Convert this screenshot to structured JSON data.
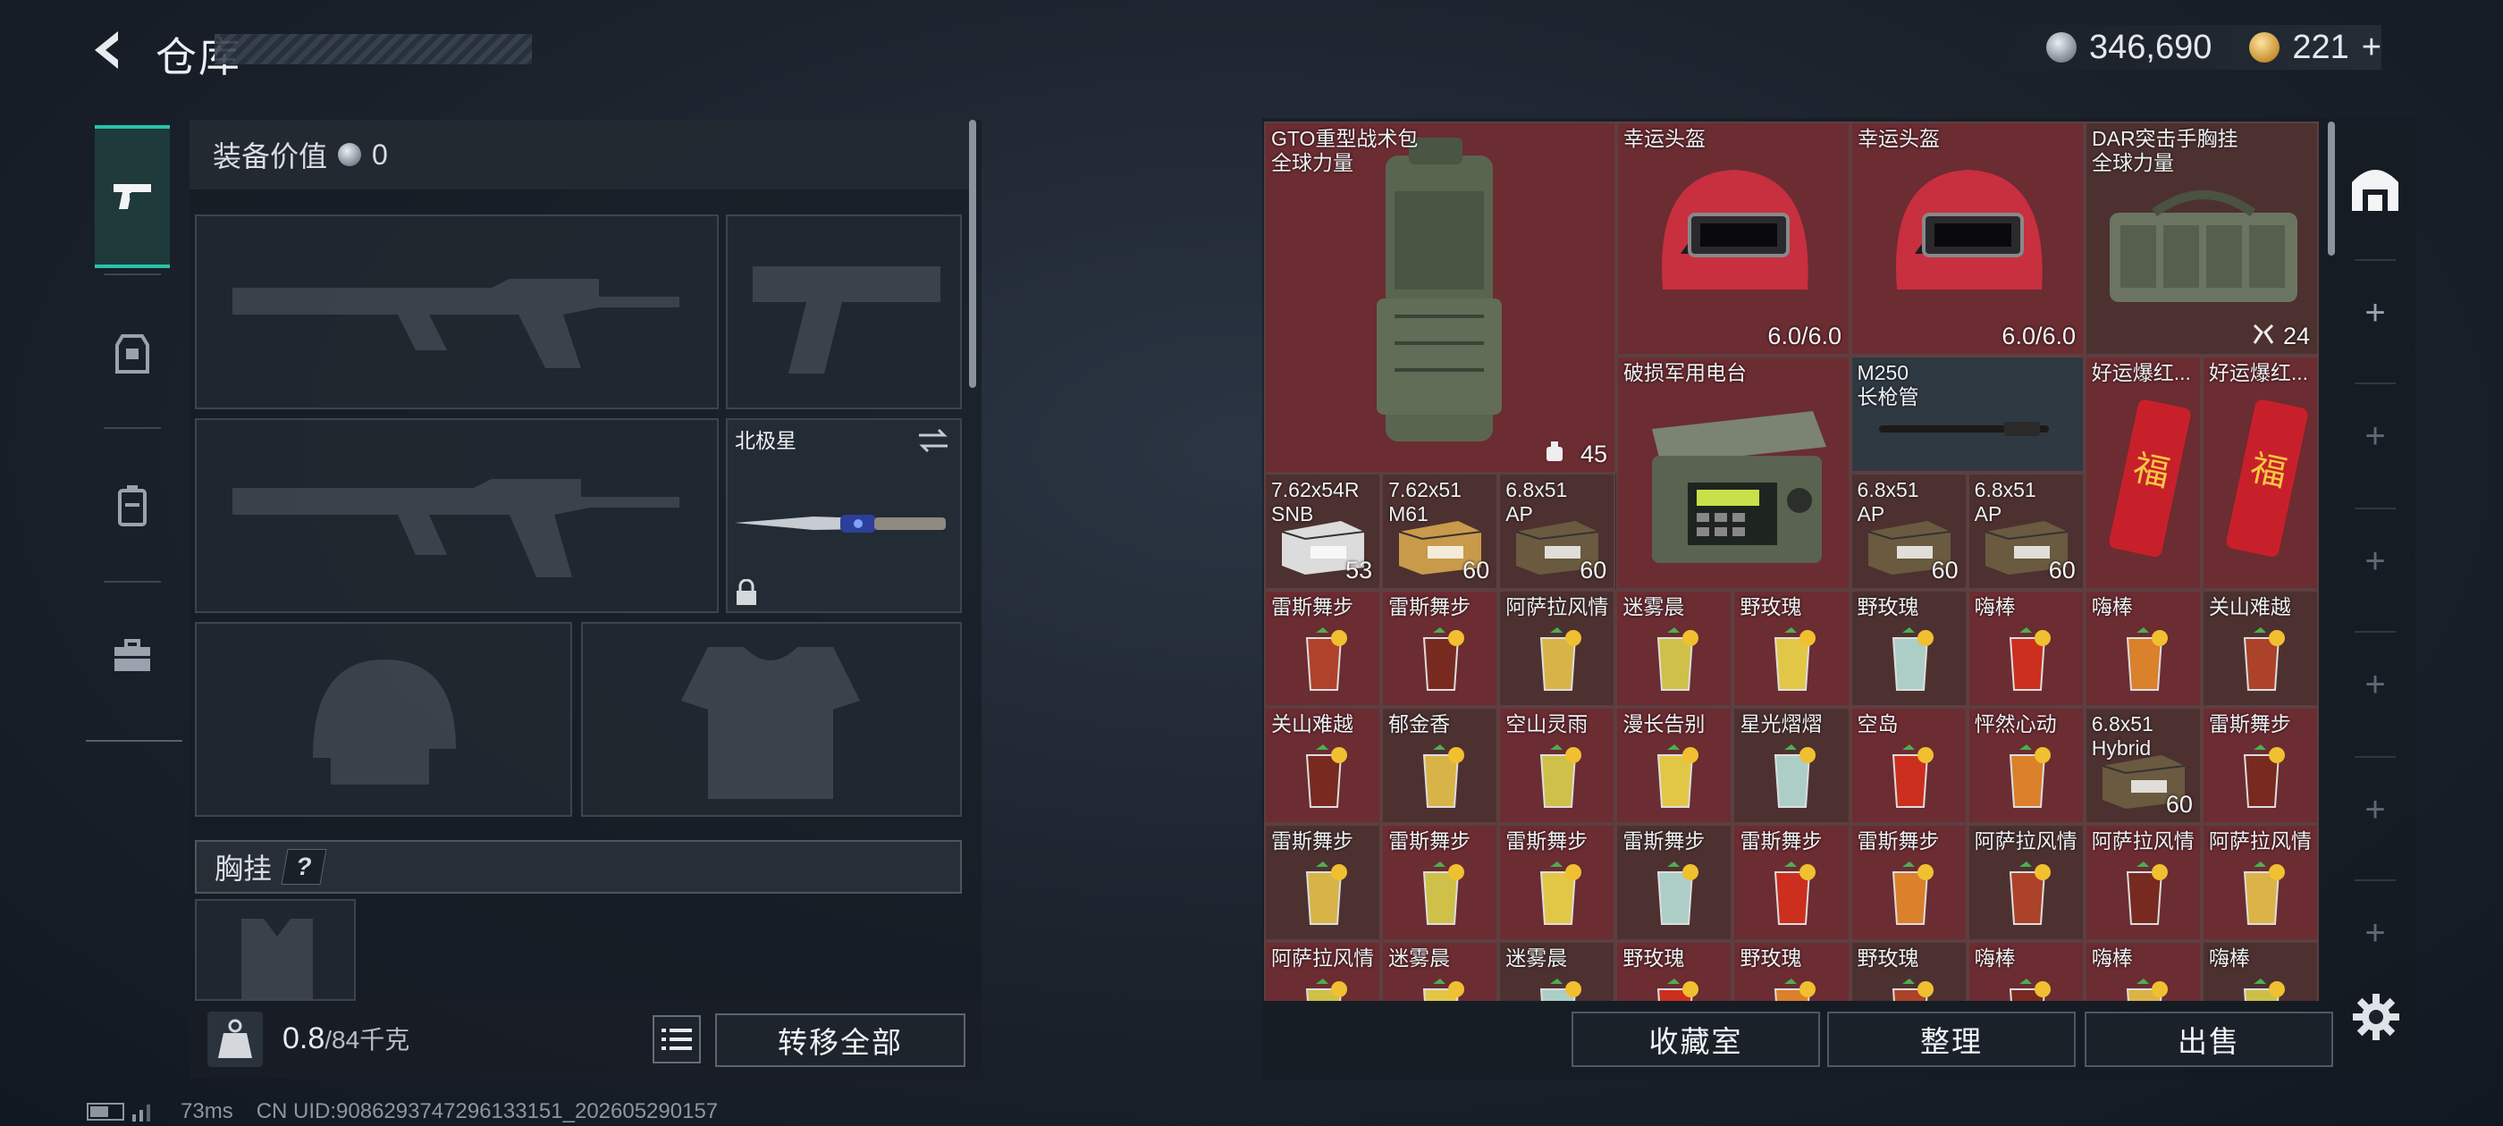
{
  "header": {
    "title": "仓库",
    "silver_amount": "346,690",
    "gold_amount": "221",
    "gold_plus": "+"
  },
  "left": {
    "equip_value_label": "装备价值",
    "equip_value": "0",
    "slot_melee_name": "北极星",
    "chest_label": "胸挂",
    "chest_help": "?",
    "weight_value": "0.8",
    "weight_max": "/84千克",
    "transfer_all": "转移全部"
  },
  "status": {
    "ping": "73ms",
    "uid": "CN UID:9086293747296133151_202605290157"
  },
  "grid": {
    "big": [
      {
        "name": "GTO重型战术包\n全球力量",
        "count": "45"
      },
      {
        "name": "幸运头盔",
        "count": "6.0/6.0"
      },
      {
        "name": "幸运头盔",
        "count": "6.0/6.0"
      },
      {
        "name": "DAR突击手胸挂\n全球力量",
        "count": "24"
      },
      {
        "name": "破损军用电台",
        "count": ""
      }
    ],
    "cells": [
      {
        "name": "M250\n长枪管",
        "count": ""
      },
      {
        "name": "好运爆红...",
        "count": ""
      },
      {
        "name": "好运爆红...",
        "count": ""
      },
      {
        "name": "7.62x54R\nSNB",
        "count": "53"
      },
      {
        "name": "7.62x51\nM61",
        "count": "60"
      },
      {
        "name": "6.8x51\nAP",
        "count": "60"
      },
      {
        "name": "6.8x51\nAP",
        "count": "60"
      },
      {
        "name": "6.8x51\nAP",
        "count": "60"
      },
      {
        "name": "雷斯舞步",
        "count": ""
      },
      {
        "name": "雷斯舞步",
        "count": ""
      },
      {
        "name": "阿萨拉风情",
        "count": ""
      },
      {
        "name": "迷雾晨",
        "count": ""
      },
      {
        "name": "野玫瑰",
        "count": ""
      },
      {
        "name": "野玫瑰",
        "count": ""
      },
      {
        "name": "嗨棒",
        "count": ""
      },
      {
        "name": "嗨棒",
        "count": ""
      },
      {
        "name": "关山难越",
        "count": ""
      },
      {
        "name": "关山难越",
        "count": ""
      },
      {
        "name": "郁金香",
        "count": ""
      },
      {
        "name": "空山灵雨",
        "count": ""
      },
      {
        "name": "漫长告别",
        "count": ""
      },
      {
        "name": "星光熠熠",
        "count": ""
      },
      {
        "name": "空岛",
        "count": ""
      },
      {
        "name": "怦然心动",
        "count": ""
      },
      {
        "name": "6.8x51\nHybrid",
        "count": "60"
      },
      {
        "name": "雷斯舞步",
        "count": ""
      },
      {
        "name": "雷斯舞步",
        "count": ""
      },
      {
        "name": "雷斯舞步",
        "count": ""
      },
      {
        "name": "雷斯舞步",
        "count": ""
      },
      {
        "name": "雷斯舞步",
        "count": ""
      },
      {
        "name": "雷斯舞步",
        "count": ""
      },
      {
        "name": "雷斯舞步",
        "count": ""
      },
      {
        "name": "阿萨拉风情",
        "count": ""
      },
      {
        "name": "阿萨拉风情",
        "count": ""
      },
      {
        "name": "阿萨拉风情",
        "count": ""
      },
      {
        "name": "阿萨拉风情",
        "count": ""
      },
      {
        "name": "迷雾晨",
        "count": ""
      },
      {
        "name": "迷雾晨",
        "count": ""
      },
      {
        "name": "野玫瑰",
        "count": ""
      },
      {
        "name": "野玫瑰",
        "count": ""
      },
      {
        "name": "野玫瑰",
        "count": ""
      },
      {
        "name": "嗨棒",
        "count": ""
      },
      {
        "name": "嗨棒",
        "count": ""
      },
      {
        "name": "嗨棒",
        "count": ""
      }
    ]
  },
  "buttons": {
    "collection": "收藏室",
    "organize": "整理",
    "sell": "出售"
  },
  "colors": {
    "accent": "#27c3a8",
    "cell_red": "#6b2c32",
    "cell_brown": "#4d3130"
  }
}
